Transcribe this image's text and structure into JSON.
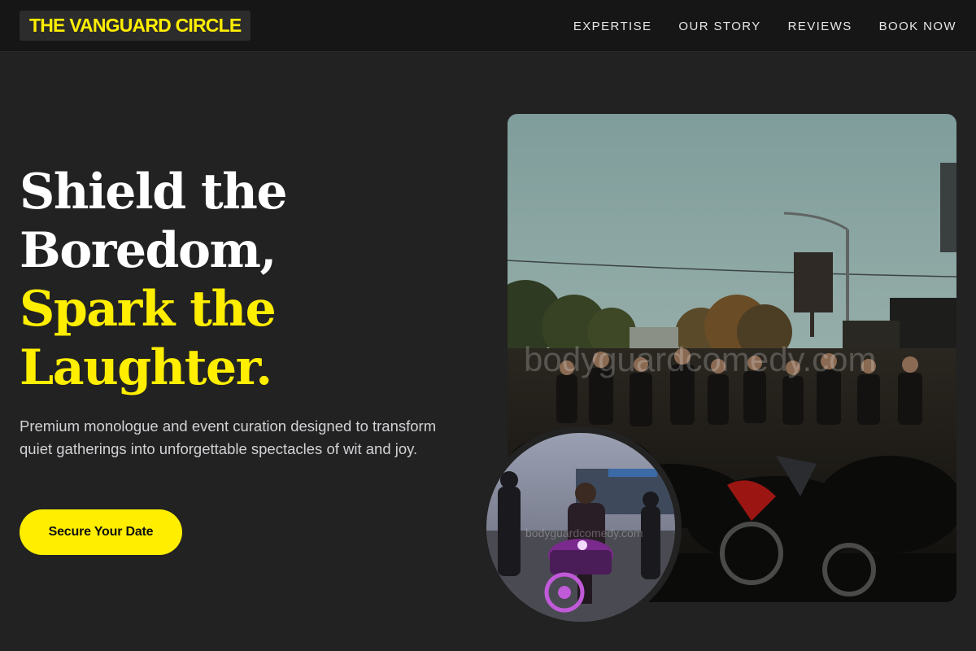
{
  "brand": {
    "name": "THE VANGUARD CIRCLE"
  },
  "nav": {
    "items": [
      {
        "label": "EXPERTISE"
      },
      {
        "label": "OUR STORY"
      },
      {
        "label": "REVIEWS"
      },
      {
        "label": "BOOK NOW"
      }
    ]
  },
  "hero": {
    "headline_white_1": "Shield the",
    "headline_white_2": "Boredom,",
    "headline_yellow_1": "Spark the",
    "headline_yellow_2": "Laughter.",
    "subtitle": "Premium monologue and event curation designed to transform quiet gatherings into unforgettable spectacles of wit and joy.",
    "cta_label": "Secure Your Date"
  },
  "images": {
    "main_watermark": "bodyguardcomedy.com",
    "circle_watermark": "bodyguardcomedy.com"
  },
  "colors": {
    "accent": "#ffee00",
    "background": "#222222",
    "navbar": "#161616"
  }
}
